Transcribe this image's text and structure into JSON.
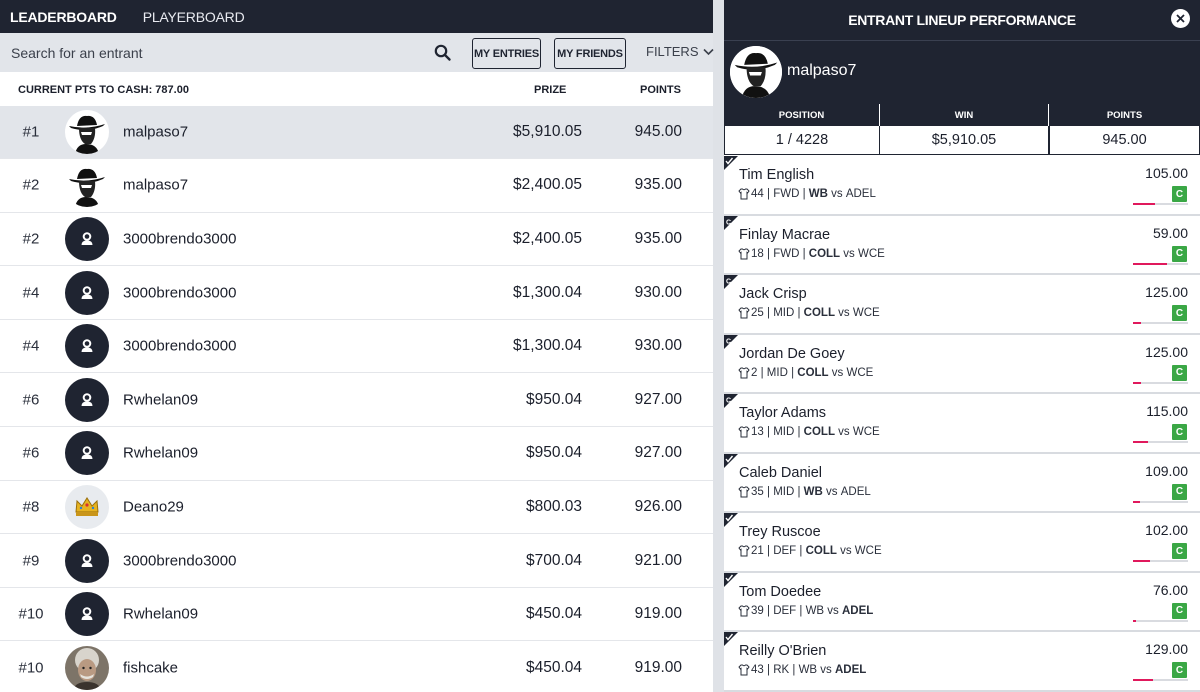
{
  "tabs": {
    "leaderboard": "LEADERBOARD",
    "playerboard": "PLAYERBOARD"
  },
  "search": {
    "placeholder": "Search for an entrant",
    "icon": "search-icon"
  },
  "buttons": {
    "my_entries": "MY ENTRIES",
    "my_friends": "MY FRIENDS",
    "filters": "FILTERS"
  },
  "columns": {
    "cash_label": "CURRENT PTS TO CASH: 787.00",
    "prize": "PRIZE",
    "points": "POINTS"
  },
  "leaderboard": [
    {
      "rank": "#1",
      "name": "malpaso7",
      "prize": "$5,910.05",
      "points": "945.00",
      "avatar": "cowboy-avatar",
      "highlighted": true
    },
    {
      "rank": "#2",
      "name": "malpaso7",
      "prize": "$2,400.05",
      "points": "935.00",
      "avatar": "cowboy-avatar"
    },
    {
      "rank": "#2",
      "name": "3000brendo3000",
      "prize": "$2,400.05",
      "points": "935.00",
      "avatar": "default-avatar"
    },
    {
      "rank": "#4",
      "name": "3000brendo3000",
      "prize": "$1,300.04",
      "points": "930.00",
      "avatar": "default-avatar"
    },
    {
      "rank": "#4",
      "name": "3000brendo3000",
      "prize": "$1,300.04",
      "points": "930.00",
      "avatar": "default-avatar"
    },
    {
      "rank": "#6",
      "name": "Rwhelan09",
      "prize": "$950.04",
      "points": "927.00",
      "avatar": "default-avatar"
    },
    {
      "rank": "#6",
      "name": "Rwhelan09",
      "prize": "$950.04",
      "points": "927.00",
      "avatar": "default-avatar"
    },
    {
      "rank": "#8",
      "name": "Deano29",
      "prize": "$800.03",
      "points": "926.00",
      "avatar": "crown-avatar"
    },
    {
      "rank": "#9",
      "name": "3000brendo3000",
      "prize": "$700.04",
      "points": "921.00",
      "avatar": "default-avatar"
    },
    {
      "rank": "#10",
      "name": "Rwhelan09",
      "prize": "$450.04",
      "points": "919.00",
      "avatar": "default-avatar"
    },
    {
      "rank": "#10",
      "name": "fishcake",
      "prize": "$450.04",
      "points": "919.00",
      "avatar": "photo-avatar"
    }
  ],
  "panel": {
    "title": "ENTRANT LINEUP PERFORMANCE",
    "username": "malpaso7",
    "stats": {
      "position_label": "POSITION",
      "position": "1 / 4228",
      "win_label": "WIN",
      "win": "$5,910.05",
      "points_label": "POINTS",
      "points": "945.00"
    },
    "players": [
      {
        "name": "Tim English",
        "num": "44",
        "pos": "FWD",
        "team": "WB",
        "opp": "ADEL",
        "team_bold": true,
        "points": "105.00",
        "status": "C",
        "progress": 0.4,
        "marker": "check"
      },
      {
        "name": "Finlay Macrae",
        "num": "18",
        "pos": "FWD",
        "team": "COLL",
        "opp": "WCE",
        "team_bold": true,
        "points": "59.00",
        "status": "C",
        "progress": 0.62,
        "marker": "captain"
      },
      {
        "name": "Jack Crisp",
        "num": "25",
        "pos": "MID",
        "team": "COLL",
        "opp": "WCE",
        "team_bold": true,
        "points": "125.00",
        "status": "C",
        "progress": 0.14,
        "marker": "captain"
      },
      {
        "name": "Jordan De Goey",
        "num": "2",
        "pos": "MID",
        "team": "COLL",
        "opp": "WCE",
        "team_bold": true,
        "points": "125.00",
        "status": "C",
        "progress": 0.14,
        "marker": "captain"
      },
      {
        "name": "Taylor Adams",
        "num": "13",
        "pos": "MID",
        "team": "COLL",
        "opp": "WCE",
        "team_bold": true,
        "points": "115.00",
        "status": "C",
        "progress": 0.27,
        "marker": "captain"
      },
      {
        "name": "Caleb Daniel",
        "num": "35",
        "pos": "MID",
        "team": "WB",
        "opp": "ADEL",
        "team_bold": true,
        "points": "109.00",
        "status": "C",
        "progress": 0.13,
        "marker": "check"
      },
      {
        "name": "Trey Ruscoe",
        "num": "21",
        "pos": "DEF",
        "team": "COLL",
        "opp": "WCE",
        "team_bold": true,
        "points": "102.00",
        "status": "C",
        "progress": 0.3,
        "marker": "check"
      },
      {
        "name": "Tom Doedee",
        "num": "39",
        "pos": "DEF",
        "team": "WB",
        "opp": "ADEL",
        "team_bold": false,
        "points": "76.00",
        "status": "C",
        "progress": 0.06,
        "marker": "check"
      },
      {
        "name": "Reilly O'Brien",
        "num": "43",
        "pos": "RK",
        "team": "WB",
        "opp": "ADEL",
        "team_bold": false,
        "points": "129.00",
        "status": "C",
        "progress": 0.36,
        "marker": "check"
      }
    ]
  }
}
